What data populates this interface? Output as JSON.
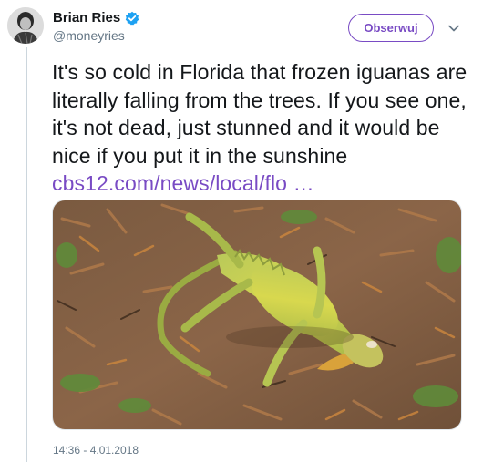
{
  "author": {
    "name": "Brian Ries",
    "handle": "@moneyries",
    "verified": true,
    "avatar_icon": "avatar-photo"
  },
  "follow_button": {
    "label": "Obserwuj"
  },
  "menu_icon": "chevron-down-icon",
  "tweet": {
    "text": "It's so cold in Florida that frozen iguanas are literally falling from the trees. If you see one, it's not dead, just stunned and it would be nice if you put it in the sunshine ",
    "link": "cbs12.com/news/local/flo …"
  },
  "media": {
    "description_icon": "iguana-photo"
  },
  "timestamp": "14:36 - 4.01.2018",
  "colors": {
    "accent": "#794bc4",
    "verified": "#1da1f2",
    "muted": "#657786"
  }
}
